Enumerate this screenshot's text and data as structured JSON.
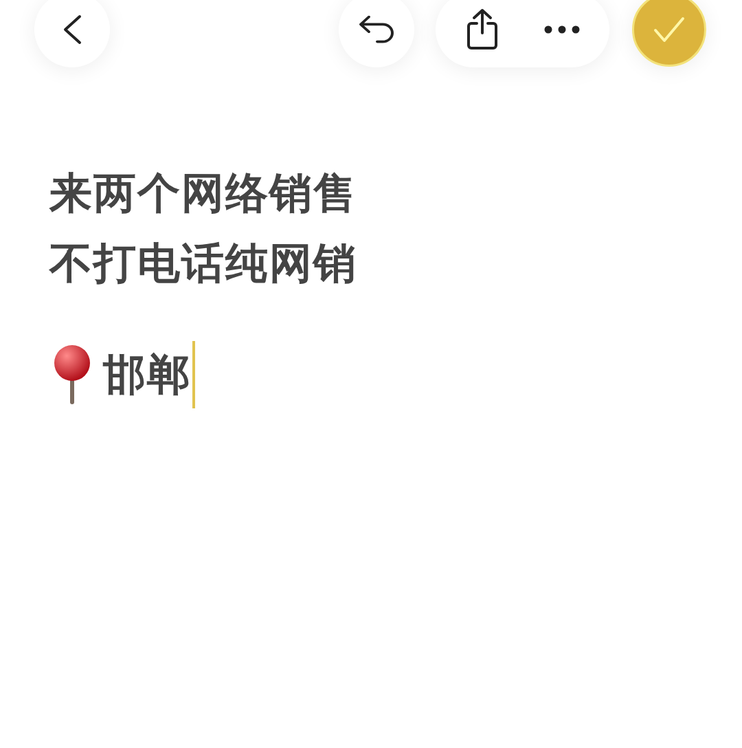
{
  "toolbar": [
    {
      "kind": "back"
    },
    {
      "kind": "undo"
    },
    {
      "kind": "group",
      "items": [
        {
          "kind": "share"
        },
        {
          "kind": "more"
        }
      ]
    },
    {
      "kind": "done"
    }
  ],
  "note": {
    "lines": [
      {
        "kind": "text",
        "text": "来两个网络销售"
      },
      {
        "kind": "text",
        "text": "不打电话纯网销"
      },
      {
        "kind": "gap"
      },
      {
        "kind": "location",
        "text": "邯郸",
        "editing": true
      }
    ]
  }
}
